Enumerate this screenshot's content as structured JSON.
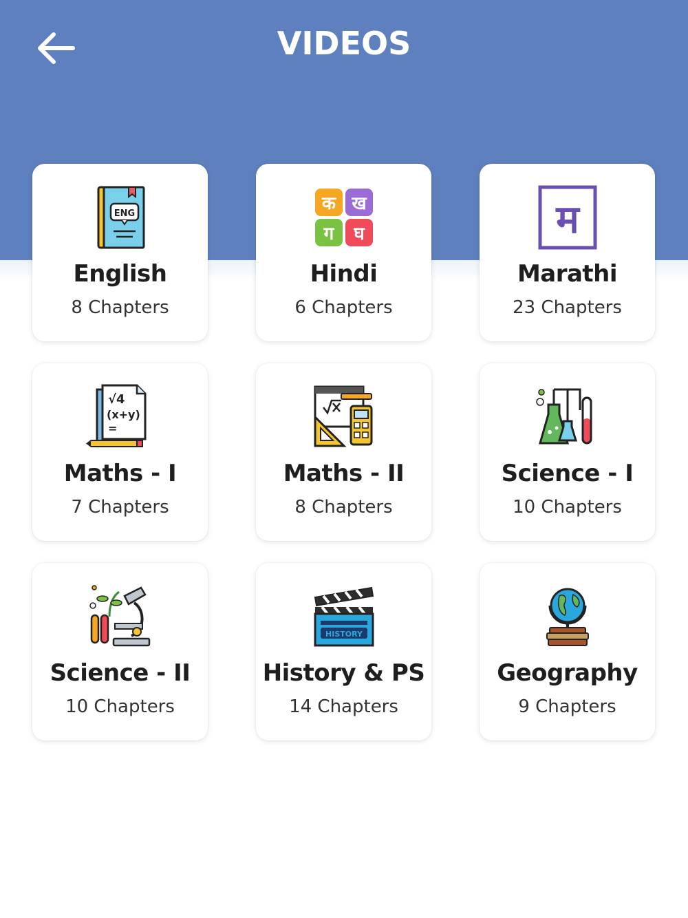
{
  "header": {
    "title": "VIDEOS",
    "back_icon": "arrow-left-icon",
    "background": "#5f80be"
  },
  "subjects": [
    {
      "name": "English",
      "chapters": "8 Chapters",
      "icon": "english-book-icon"
    },
    {
      "name": "Hindi",
      "chapters": "6 Chapters",
      "icon": "hindi-letters-icon"
    },
    {
      "name": "Marathi",
      "chapters": "23 Chapters",
      "icon": "marathi-letter-icon"
    },
    {
      "name": "Maths - I",
      "chapters": "7 Chapters",
      "icon": "algebra-paper-icon"
    },
    {
      "name": "Maths - II",
      "chapters": "8 Chapters",
      "icon": "geometry-tools-icon"
    },
    {
      "name": "Science - I",
      "chapters": "10 Chapters",
      "icon": "lab-flasks-icon"
    },
    {
      "name": "Science - II",
      "chapters": "10 Chapters",
      "icon": "microscope-plant-icon"
    },
    {
      "name": "History & PS",
      "chapters": "14 Chapters",
      "icon": "history-clapper-icon"
    },
    {
      "name": "Geography",
      "chapters": "9 Chapters",
      "icon": "globe-books-icon"
    }
  ],
  "hindi_letters": [
    "क",
    "ख",
    "ग",
    "घ"
  ],
  "marathi_letter": "म",
  "english_badge": "ENG",
  "maths_text": [
    "√4",
    "(x+y)",
    "="
  ],
  "history_label": "HISTORY"
}
